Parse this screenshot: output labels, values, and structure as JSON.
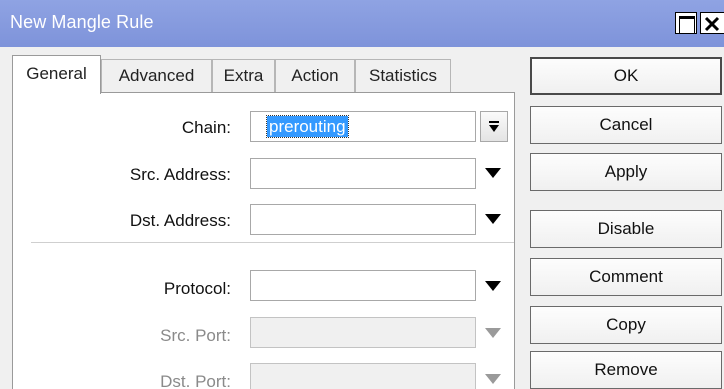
{
  "window": {
    "title": "New Mangle Rule"
  },
  "tabs": [
    {
      "label": "General",
      "active": true
    },
    {
      "label": "Advanced"
    },
    {
      "label": "Extra"
    },
    {
      "label": "Action"
    },
    {
      "label": "Statistics"
    }
  ],
  "form": {
    "chain": {
      "label": "Chain:",
      "value": "prerouting"
    },
    "src_address": {
      "label": "Src. Address:",
      "value": ""
    },
    "dst_address": {
      "label": "Dst. Address:",
      "value": ""
    },
    "protocol": {
      "label": "Protocol:",
      "value": ""
    },
    "src_port": {
      "label": "Src. Port:",
      "value": "",
      "enabled": false
    },
    "dst_port": {
      "label": "Dst. Port:",
      "value": "",
      "enabled": false
    }
  },
  "buttons": {
    "ok": "OK",
    "cancel": "Cancel",
    "apply": "Apply",
    "disable": "Disable",
    "comment": "Comment",
    "copy": "Copy",
    "remove": "Remove"
  },
  "icons": {
    "maximize": "maximize-icon",
    "close": "close-icon",
    "dropdown": "triangle-down-icon",
    "combo": "combo-dropdown-icon"
  },
  "colors": {
    "titlebar": "#8297dd",
    "selection": "#3399ff",
    "disabled_text": "#8a8a8a"
  }
}
